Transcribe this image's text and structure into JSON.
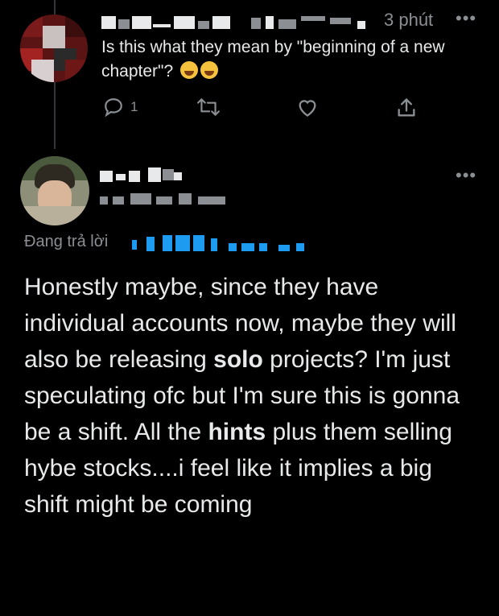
{
  "parent_tweet": {
    "time": "3 phút",
    "more_icon": "more-horizontal-icon",
    "text": "Is this what they mean by \"beginning of a new chapter\"?",
    "emojis": [
      "face-with-tears-of-joy-emoji",
      "face-with-tears-of-joy-emoji"
    ],
    "actions": {
      "reply_icon": "reply-icon",
      "reply_count": "1",
      "retweet_icon": "retweet-icon",
      "like_icon": "heart-icon",
      "share_icon": "share-icon"
    }
  },
  "reply_tweet": {
    "more_icon": "more-horizontal-icon",
    "replying_to_label": "Đang trả lời",
    "text_parts": [
      "Honestly maybe, since they have individual accounts now, maybe they will also be releasing ",
      "solo",
      " projects? I'm just speculating ofc but I'm sure this is gonna be a shift. All the ",
      "hints",
      " plus them selling hybe stocks....i feel like it implies a big shift might be coming"
    ]
  },
  "colors": {
    "background": "#000000",
    "text": "#e7e9ea",
    "secondary": "#8b8f94",
    "accent_blue": "#1d9bf0",
    "thread_line": "#333639"
  }
}
